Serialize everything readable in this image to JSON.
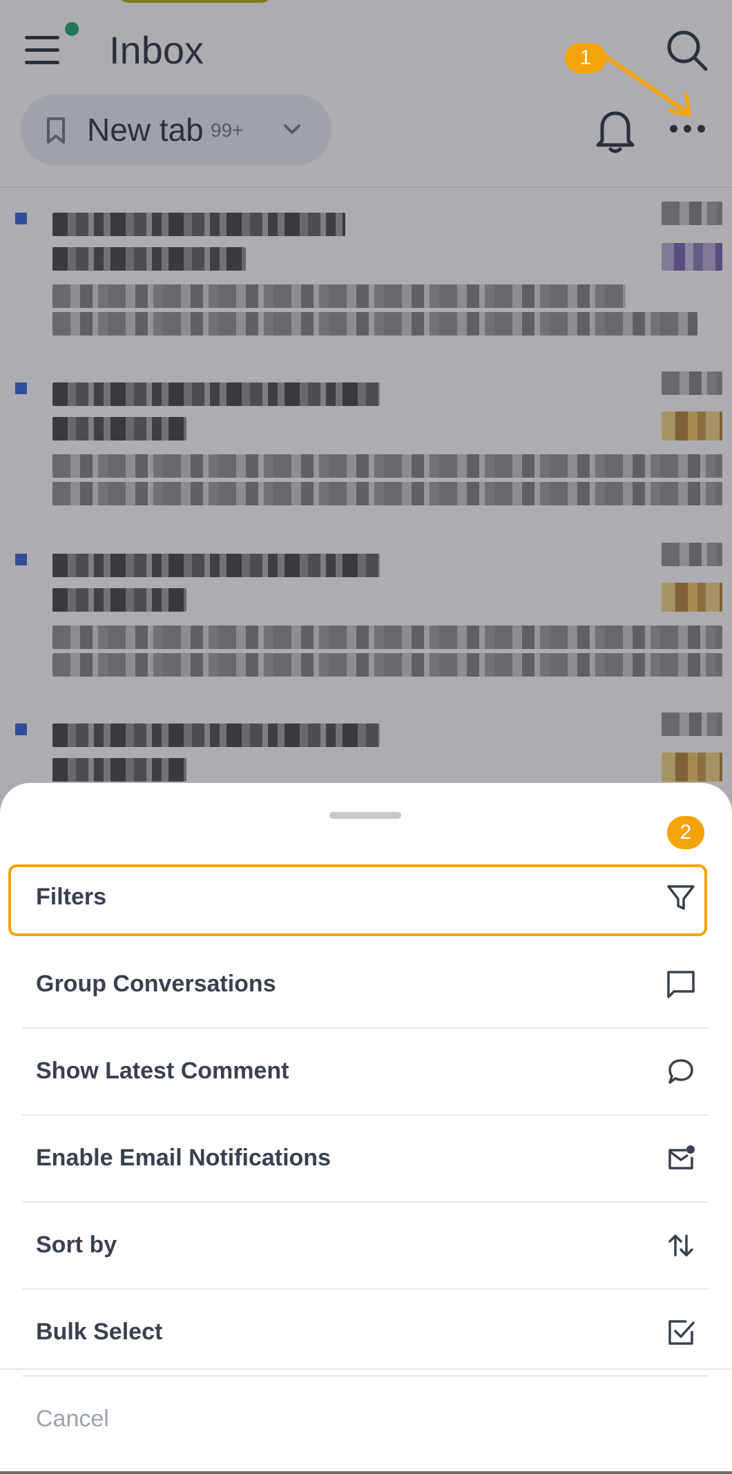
{
  "header": {
    "title": "Inbox",
    "tab": {
      "label": "New tab",
      "count": "99+"
    }
  },
  "annotations": {
    "step1": "1",
    "step2": "2"
  },
  "sheet": {
    "items": [
      {
        "label": "Filters",
        "icon": "filter-icon"
      },
      {
        "label": "Group Conversations",
        "icon": "chat-square-icon"
      },
      {
        "label": "Show Latest Comment",
        "icon": "chat-bubble-icon"
      },
      {
        "label": "Enable Email Notifications",
        "icon": "mail-notification-icon"
      },
      {
        "label": "Sort by",
        "icon": "sort-arrows-icon"
      },
      {
        "label": "Bulk Select",
        "icon": "checkbox-icon"
      }
    ],
    "cancel_label": "Cancel"
  },
  "colors": {
    "accent": "#f5a30a",
    "online": "#10a36b",
    "unread": "#2b5cd6"
  }
}
